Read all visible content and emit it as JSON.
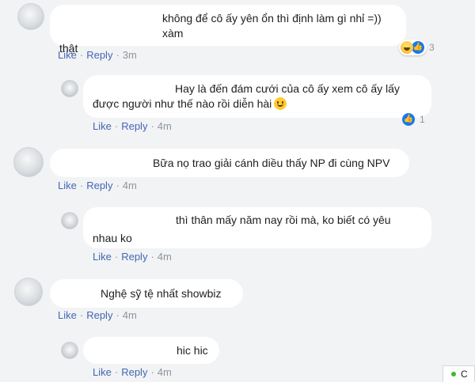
{
  "comments": [
    {
      "lines": [
        "không để cô ấy yên ổn thì định làm gì nhỉ =)) xàm",
        "thật"
      ],
      "like": "Like",
      "reply": "Reply",
      "time": "3m",
      "reaction_count": "3",
      "reaction_icons": [
        "haha-icon",
        "like-icon"
      ]
    },
    {
      "lines": [
        "Hay là đến đám cưới của cô ấy xem cô ấy lấy",
        "được người như thế nào rồi diễn hài"
      ],
      "emoji": "smile-emoji-icon",
      "like": "Like",
      "reply": "Reply",
      "time": "4m",
      "reaction_count": "1",
      "reaction_icons": [
        "like-icon"
      ]
    },
    {
      "lines": [
        "Bữa nọ trao giải cánh diều thấy NP đi cùng NPV"
      ],
      "like": "Like",
      "reply": "Reply",
      "time": "4m"
    },
    {
      "lines": [
        "thì thân mấy năm nay rồi mà, ko biết có yêu",
        "nhau ko"
      ],
      "like": "Like",
      "reply": "Reply",
      "time": "4m"
    },
    {
      "lines": [
        "Nghệ sỹ tệ nhất showbiz"
      ],
      "like": "Like",
      "reply": "Reply",
      "time": "4m"
    },
    {
      "lines": [
        "hic hic"
      ],
      "like": "Like",
      "reply": "Reply",
      "time": "4m"
    }
  ],
  "separator": "·",
  "chat": {
    "label": "C",
    "status_color": "#42b72a"
  },
  "colors": {
    "background": "#f2f3f5",
    "link": "#4267b2",
    "meta": "#90949c"
  }
}
